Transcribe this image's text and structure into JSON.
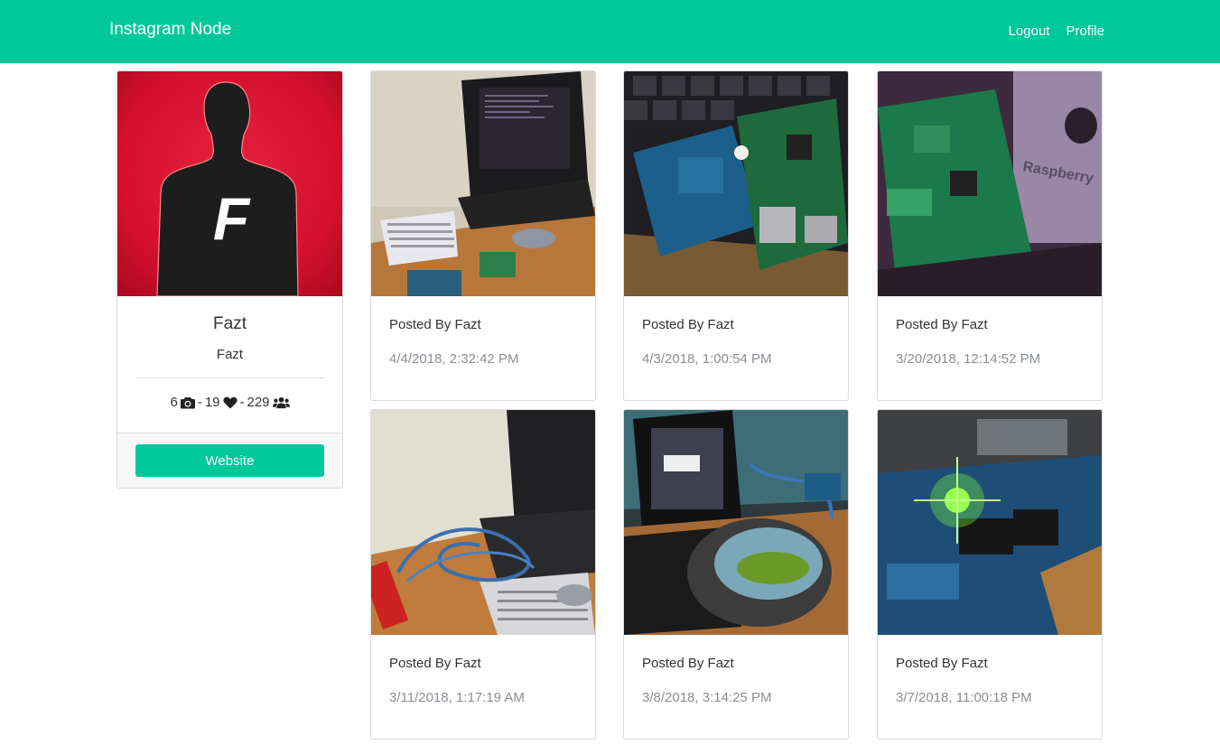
{
  "navbar": {
    "brand": "Instagram Node",
    "links": [
      "Logout",
      "Profile"
    ],
    "color": "#00c89b"
  },
  "profile": {
    "name": "Fazt",
    "username": "Fazt",
    "stats": {
      "photos": "6",
      "sep1": "-",
      "likes": "19",
      "sep2": "-",
      "views": "229"
    },
    "icons": [
      "camera-icon",
      "heart-icon",
      "users-icon"
    ],
    "website_label": "Website",
    "avatar_letter": "F"
  },
  "posts": [
    {
      "author": "Posted By Fazt",
      "date": "4/4/2018, 2:32:42 PM"
    },
    {
      "author": "Posted By Fazt",
      "date": "4/3/2018, 1:00:54 PM"
    },
    {
      "author": "Posted By Fazt",
      "date": "3/20/2018, 12:14:52 PM"
    },
    {
      "author": "Posted By Fazt",
      "date": "3/11/2018, 1:17:19 AM"
    },
    {
      "author": "Posted By Fazt",
      "date": "3/8/2018, 3:14:25 PM"
    },
    {
      "author": "Posted By Fazt",
      "date": "3/7/2018, 11:00:18 PM"
    }
  ]
}
